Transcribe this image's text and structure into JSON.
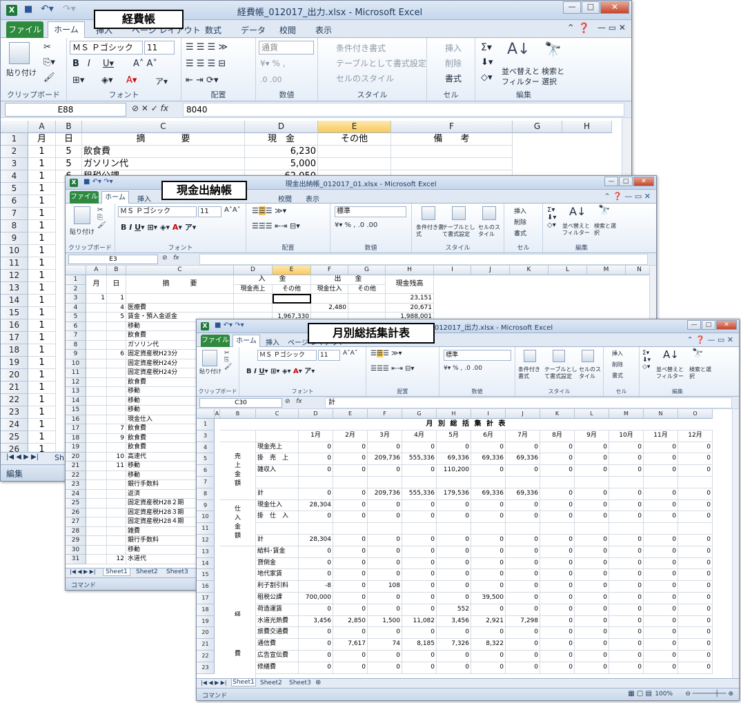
{
  "app": {
    "name": "Microsoft Excel"
  },
  "ribbon_tabs": [
    "ファイル",
    "ホーム",
    "挿入",
    "ページ レイアウト",
    "数式",
    "データ",
    "校閲",
    "表示"
  ],
  "labels": {
    "expense": "経費帳",
    "cash": "現金出納帳",
    "monthly": "月別総括集計表"
  },
  "win1": {
    "title": "経費帳_012017_出力.xlsx - Microsoft Excel",
    "font_name": "ＭＳ Ｐゴシック",
    "font_size": "11",
    "number_format": "通貨",
    "groups": {
      "clipboard": "クリップボード",
      "font": "フォント",
      "align": "配置",
      "number": "数値",
      "style": "スタイル",
      "cells": "セル",
      "edit": "編集"
    },
    "buttons": {
      "paste": "貼り付け",
      "cond": "条件付き書式",
      "table": "テーブルとして書式設定",
      "cellstyle": "セルのスタイル",
      "insert": "挿入",
      "delete": "削除",
      "format": "書式",
      "sort": "並べ替えと",
      "filter": "フィルター",
      "find": "検索と",
      "select": "選択"
    },
    "namebox": "E88",
    "formula": "8040",
    "cols": [
      "A",
      "B",
      "C",
      "D",
      "E",
      "F",
      "G",
      "H"
    ],
    "header": [
      "月",
      "日",
      "摘　　　　要",
      "現　金",
      "その他",
      "備　　考"
    ],
    "rows": [
      [
        "1",
        "5",
        "飲食費",
        "6,230"
      ],
      [
        "1",
        "5",
        "ガソリン代",
        "5,000"
      ],
      [
        "1",
        "6",
        "租税公課",
        "62,050"
      ]
    ],
    "row_numbers": [
      "1",
      "2",
      "3",
      "4",
      "5",
      "6",
      "7",
      "8",
      "9",
      "10",
      "11",
      "12",
      "13",
      "14",
      "15",
      "16",
      "17",
      "18",
      "19",
      "20",
      "21",
      "22",
      "23",
      "24",
      "25",
      "26"
    ],
    "col_a_rest": [
      "1",
      "1",
      "1",
      "1",
      "1",
      "1",
      "1",
      "1",
      "1",
      "1",
      "1",
      "1",
      "1",
      "1",
      "1",
      "1",
      "1",
      "1",
      "1",
      "1",
      "1",
      "1"
    ],
    "sheet_tab": "Sh",
    "status": "編集"
  },
  "win2": {
    "title": "現金出納帳_012017_01.xlsx - Microsoft Excel",
    "font_name": "ＭＳ Ｐゴシック",
    "font_size": "11",
    "number_format": "標準",
    "groups": {
      "clipboard": "クリップボード",
      "font": "フォント",
      "align": "配置",
      "number": "数値",
      "style": "スタイル",
      "cells": "セル",
      "edit": "編集"
    },
    "buttons": {
      "paste": "貼り付け",
      "cond": "条件付き書式",
      "table": "テーブルとして書式設定",
      "cellstyle": "セルのスタイル",
      "insert": "挿入",
      "delete": "削除",
      "format": "書式",
      "sort": "並べ替えとフィルター",
      "find": "検索と選択"
    },
    "namebox": "E3",
    "formula": "",
    "cols": [
      "A",
      "B",
      "C",
      "D",
      "E",
      "F",
      "G",
      "H",
      "I",
      "J",
      "K",
      "L",
      "M",
      "N"
    ],
    "hdr_top": {
      "month": "月",
      "day": "日",
      "desc": "摘　　　要",
      "in": "入　　金",
      "out": "出　　金",
      "bal": "現金残高"
    },
    "hdr_sub": [
      "現金売上",
      "その他",
      "現金仕入",
      "その他"
    ],
    "rows": [
      {
        "r": "3",
        "a": "1",
        "b": "1",
        "c": "",
        "d": "",
        "e": "",
        "f": "",
        "g": "",
        "h": "23,151"
      },
      {
        "r": "4",
        "a": "",
        "b": "4",
        "c": "医療費",
        "d": "",
        "e": "",
        "f": "2,480",
        "g": "",
        "h": "20,671"
      },
      {
        "r": "5",
        "a": "",
        "b": "5",
        "c": "賃金・預入金返金",
        "d": "",
        "e": "1,967,330",
        "f": "",
        "g": "",
        "h": "1,988,001"
      },
      {
        "r": "6",
        "a": "",
        "b": "",
        "c": "移動"
      },
      {
        "r": "7",
        "a": "",
        "b": "",
        "c": "飲食費"
      },
      {
        "r": "8",
        "a": "",
        "b": "",
        "c": "ガソリン代"
      },
      {
        "r": "9",
        "a": "",
        "b": "6",
        "c": "固定資産税H23分"
      },
      {
        "r": "10",
        "a": "",
        "b": "",
        "c": "固定資産税H24分"
      },
      {
        "r": "11",
        "a": "",
        "b": "",
        "c": "固定資産税H24分"
      },
      {
        "r": "12",
        "a": "",
        "b": "",
        "c": "飲食費"
      },
      {
        "r": "13",
        "a": "",
        "b": "",
        "c": "移動"
      },
      {
        "r": "14",
        "a": "",
        "b": "",
        "c": "移動"
      },
      {
        "r": "15",
        "a": "",
        "b": "",
        "c": "移動"
      },
      {
        "r": "16",
        "a": "",
        "b": "",
        "c": "現金仕入"
      },
      {
        "r": "17",
        "a": "",
        "b": "7",
        "c": "飲食費"
      },
      {
        "r": "18",
        "a": "",
        "b": "9",
        "c": "飲食費"
      },
      {
        "r": "19",
        "a": "",
        "b": "",
        "c": "飲食費"
      },
      {
        "r": "20",
        "a": "",
        "b": "10",
        "c": "高速代"
      },
      {
        "r": "21",
        "a": "",
        "b": "11",
        "c": "移動"
      },
      {
        "r": "22",
        "a": "",
        "b": "",
        "c": "移動"
      },
      {
        "r": "23",
        "a": "",
        "b": "",
        "c": "銀行手数料"
      },
      {
        "r": "24",
        "a": "",
        "b": "",
        "c": "返済"
      },
      {
        "r": "25",
        "a": "",
        "b": "",
        "c": "固定資産税H28２期"
      },
      {
        "r": "26",
        "a": "",
        "b": "",
        "c": "固定資産税H28３期"
      },
      {
        "r": "27",
        "a": "",
        "b": "",
        "c": "固定資産税H28４期"
      },
      {
        "r": "28",
        "a": "",
        "b": "",
        "c": "雑費"
      },
      {
        "r": "29",
        "a": "",
        "b": "",
        "c": "銀行手数料"
      },
      {
        "r": "30",
        "a": "",
        "b": "",
        "c": "移動"
      },
      {
        "r": "31",
        "a": "",
        "b": "12",
        "c": "水道代"
      }
    ],
    "sheet_tabs": [
      "Sheet1",
      "Sheet2",
      "Sheet3"
    ],
    "status": "コマンド"
  },
  "win3": {
    "title": "月別総括集計表_012017_出力.xlsx - Microsoft Excel",
    "font_name": "ＭＳ Ｐゴシック",
    "font_size": "11",
    "number_format": "標準",
    "groups": {
      "clipboard": "クリップボード",
      "font": "フォント",
      "align": "配置",
      "number": "数値",
      "style": "スタイル",
      "cells": "セル",
      "edit": "編集"
    },
    "buttons": {
      "paste": "貼り付け",
      "cond": "条件付き書式",
      "table": "テーブルとして書式設定",
      "cellstyle": "セルのスタイル",
      "insert": "挿入",
      "delete": "削除",
      "format": "書式",
      "sort": "並べ替えとフィルター",
      "find": "検索と選択"
    },
    "namebox": "C30",
    "formula": "計",
    "cols": [
      "A",
      "B",
      "C",
      "D",
      "E",
      "F",
      "G",
      "H",
      "I",
      "J",
      "K",
      "L",
      "M",
      "N",
      "O"
    ],
    "sheet_title": "月 別 総 括 集 計 表",
    "months": [
      "1月",
      "2月",
      "3月",
      "4月",
      "5月",
      "6月",
      "7月",
      "8月",
      "9月",
      "10月",
      "11月",
      "12月"
    ],
    "group_labels": {
      "sales": "売上金額",
      "purchase": "仕入金額",
      "exp1": "経",
      "exp2": "費"
    },
    "rows": [
      {
        "r": "4",
        "c": "現金売上",
        "v": [
          "0",
          "0",
          "0",
          "0",
          "0",
          "0",
          "0",
          "0",
          "0",
          "0",
          "0",
          "0"
        ]
      },
      {
        "r": "5",
        "c": "掛　売　上",
        "v": [
          "0",
          "0",
          "209,736",
          "555,336",
          "69,336",
          "69,336",
          "69,336",
          "0",
          "0",
          "0",
          "0",
          "0"
        ]
      },
      {
        "r": "6",
        "c": "雑収入",
        "v": [
          "0",
          "0",
          "0",
          "0",
          "110,200",
          "0",
          "0",
          "0",
          "0",
          "0",
          "0",
          "0"
        ]
      },
      {
        "r": "7",
        "c": "",
        "v": [
          "",
          "",
          "",
          "",
          "",
          "",
          "",
          "",
          "",
          "",
          "",
          ""
        ]
      },
      {
        "r": "8",
        "c": "計",
        "v": [
          "0",
          "0",
          "209,736",
          "555,336",
          "179,536",
          "69,336",
          "69,336",
          "0",
          "0",
          "0",
          "0",
          "0"
        ]
      },
      {
        "r": "9",
        "c": "現金仕入",
        "v": [
          "28,304",
          "0",
          "0",
          "0",
          "0",
          "0",
          "0",
          "0",
          "0",
          "0",
          "0",
          "0"
        ]
      },
      {
        "r": "10",
        "c": "掛　仕　入",
        "v": [
          "0",
          "0",
          "0",
          "0",
          "0",
          "0",
          "0",
          "0",
          "0",
          "0",
          "0",
          "0"
        ]
      },
      {
        "r": "11",
        "c": "",
        "v": [
          "",
          "",
          "",
          "",
          "",
          "",
          "",
          "",
          "",
          "",
          "",
          ""
        ]
      },
      {
        "r": "12",
        "c": "計",
        "v": [
          "28,304",
          "0",
          "0",
          "0",
          "0",
          "0",
          "0",
          "0",
          "0",
          "0",
          "0",
          "0"
        ]
      },
      {
        "r": "13",
        "c": "給料･賃金",
        "v": [
          "0",
          "0",
          "0",
          "0",
          "0",
          "0",
          "0",
          "0",
          "0",
          "0",
          "0",
          "0"
        ]
      },
      {
        "r": "14",
        "c": "貸倒金",
        "v": [
          "0",
          "0",
          "0",
          "0",
          "0",
          "0",
          "0",
          "0",
          "0",
          "0",
          "0",
          "0"
        ]
      },
      {
        "r": "15",
        "c": "地代家賃",
        "v": [
          "0",
          "0",
          "0",
          "0",
          "0",
          "0",
          "0",
          "0",
          "0",
          "0",
          "0",
          "0"
        ]
      },
      {
        "r": "16",
        "c": "利子割引料",
        "v": [
          "-8",
          "0",
          "108",
          "0",
          "0",
          "0",
          "0",
          "0",
          "0",
          "0",
          "0",
          "0"
        ]
      },
      {
        "r": "17",
        "c": "租税公課",
        "v": [
          "700,000",
          "0",
          "0",
          "0",
          "0",
          "39,500",
          "0",
          "0",
          "0",
          "0",
          "0",
          "0"
        ]
      },
      {
        "r": "18",
        "c": "荷造運賃",
        "v": [
          "0",
          "0",
          "0",
          "0",
          "552",
          "0",
          "0",
          "0",
          "0",
          "0",
          "0",
          "0"
        ]
      },
      {
        "r": "19",
        "c": "水道光熱費",
        "v": [
          "3,456",
          "2,850",
          "1,500",
          "11,082",
          "3,456",
          "2,921",
          "7,298",
          "0",
          "0",
          "0",
          "0",
          "0"
        ]
      },
      {
        "r": "20",
        "c": "旅費交通費",
        "v": [
          "0",
          "0",
          "0",
          "0",
          "0",
          "0",
          "0",
          "0",
          "0",
          "0",
          "0",
          "0"
        ]
      },
      {
        "r": "21",
        "c": "通信費",
        "v": [
          "0",
          "7,617",
          "74",
          "8,185",
          "7,326",
          "8,322",
          "0",
          "0",
          "0",
          "0",
          "0",
          "0"
        ]
      },
      {
        "r": "22",
        "c": "広告宣伝費",
        "v": [
          "0",
          "0",
          "0",
          "0",
          "0",
          "0",
          "0",
          "0",
          "0",
          "0",
          "0",
          "0"
        ]
      },
      {
        "r": "23",
        "c": "修繕費",
        "v": [
          "0",
          "0",
          "0",
          "0",
          "0",
          "0",
          "0",
          "0",
          "0",
          "0",
          "0",
          "0"
        ]
      },
      {
        "r": "24",
        "c": "消耗品費",
        "v": [
          "0",
          "5,385",
          "0",
          "0",
          "108",
          "0",
          "0",
          "0",
          "0",
          "0",
          "0",
          "0"
        ]
      }
    ],
    "sheet_tabs": [
      "Sheet1",
      "Sheet2",
      "Sheet3"
    ],
    "status": "コマンド",
    "zoom": "100%"
  }
}
